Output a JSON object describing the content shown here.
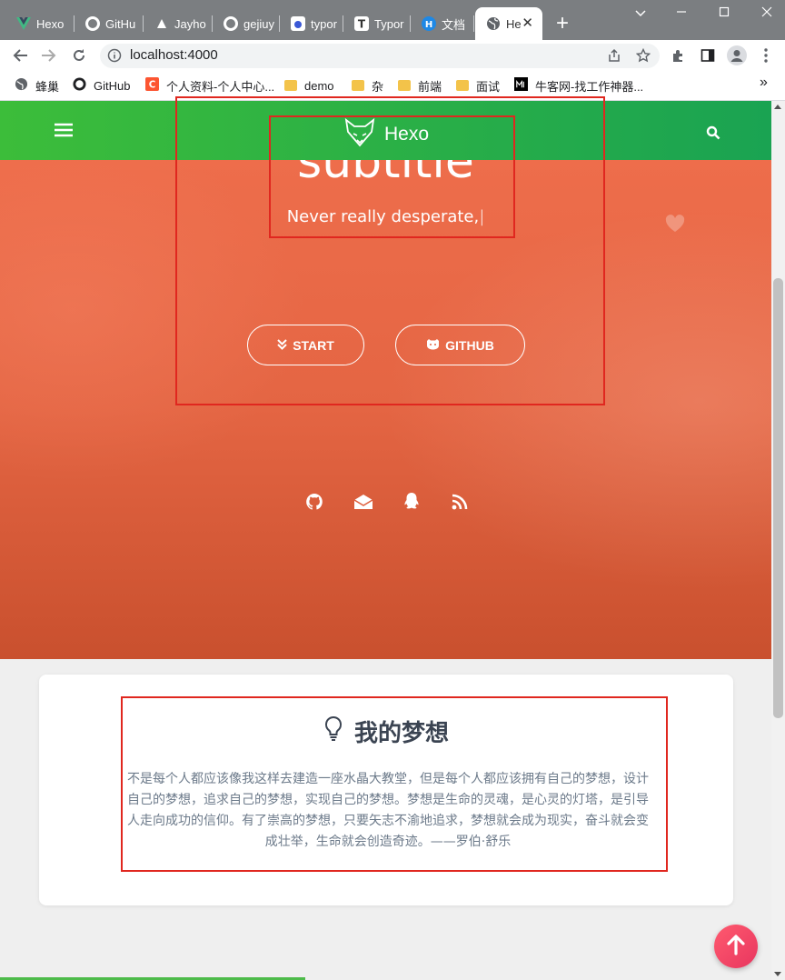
{
  "browser": {
    "tabs": [
      {
        "label": "Hexo",
        "icon": "vue-logo-icon"
      },
      {
        "label": "GitHu",
        "icon": "github-icon"
      },
      {
        "label": "Jayho",
        "icon": "reader-icon"
      },
      {
        "label": "gejiuy",
        "icon": "github-icon"
      },
      {
        "label": "typor",
        "icon": "baidu-icon"
      },
      {
        "label": "Typor",
        "icon": "typora-icon"
      },
      {
        "label": "文档",
        "icon": "h-logo-icon"
      },
      {
        "label": "He",
        "icon": "globe-icon",
        "active": true
      }
    ],
    "new_tab": "+",
    "url": "localhost:4000",
    "bookmarks": [
      {
        "label": "蜂巢",
        "icon": "globe-icon"
      },
      {
        "label": "GitHub",
        "icon": "github-icon"
      },
      {
        "label": "个人资料-个人中心...",
        "icon": "csdn-icon"
      },
      {
        "label": "demo",
        "icon": "folder-icon"
      },
      {
        "label": "杂",
        "icon": "folder-icon"
      },
      {
        "label": "前端",
        "icon": "folder-icon"
      },
      {
        "label": "面试",
        "icon": "folder-icon"
      },
      {
        "label": "牛客网-找工作神器...",
        "icon": "nowcoder-icon"
      }
    ],
    "more_bookmarks": "»"
  },
  "site": {
    "brand": "Hexo",
    "subtitle": "subtitle",
    "typed_text": "Never really desperate,",
    "buttons": {
      "start": "START",
      "github": "GITHUB"
    },
    "social_icons": [
      "github-icon",
      "mail-icon",
      "qq-icon",
      "rss-icon"
    ]
  },
  "dream": {
    "title": "我的梦想",
    "text": "不是每个人都应该像我这样去建造一座水晶大教堂，但是每个人都应该拥有自己的梦想，设计自己的梦想，追求自己的梦想，实现自己的梦想。梦想是生命的灵魂，是心灵的灯塔，是引导人走向成功的信仰。有了崇高的梦想，只要矢志不渝地追求，梦想就会成为现实，奋斗就会变成壮举，生命就会创造奇迹。——罗伯·舒乐"
  },
  "colors": {
    "navbar": "#1aa352",
    "hero": "#e46543",
    "annotation": "#e0271f",
    "back_to_top": "#e8365f"
  }
}
